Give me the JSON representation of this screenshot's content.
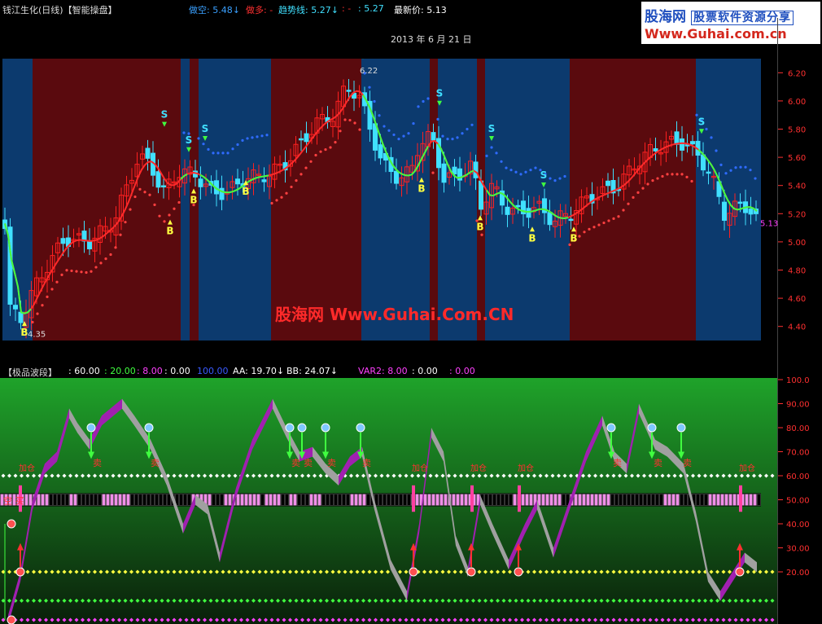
{
  "header": {
    "stock_title": "钱江生化(日线)【智能操盘】",
    "indicators": [
      {
        "label": "做空: 5.48↓",
        "color": "#3aa0ff"
      },
      {
        "label": "做多: -",
        "color": "#ff3030"
      },
      {
        "label": "趋势线: 5.27↓",
        "color": "#40e0ff"
      },
      {
        "label": ": - ",
        "color": "#ff3030"
      },
      {
        "label": ": 5.27",
        "color": "#40e0ff"
      },
      {
        "label": "最新价: 5.13",
        "color": "#ffffff"
      }
    ],
    "date": "2013 年 6 月 21 日"
  },
  "logo": {
    "brand": "股海网",
    "slogan": "股票软件资源分享",
    "url": "Www.Guhai.com.cn"
  },
  "watermark": "股海网 Www.Guhai.Com.CN",
  "price_axis": [
    "6.20",
    "6.00",
    "5.80",
    "5.60",
    "5.40",
    "5.20",
    "5.00",
    "4.80",
    "4.60",
    "4.40"
  ],
  "price_annotations": {
    "high": "6.22",
    "low": "4.35",
    "last": "5.13"
  },
  "signal_letters": {
    "sell": "S",
    "buy": "B"
  },
  "indicator_panel": {
    "name": "【极品波段】",
    "values": [
      {
        "label": ": 60.00",
        "color": "#ffffff"
      },
      {
        "label": ": 20.00",
        "color": "#40ff40"
      },
      {
        "label": ": 8.00",
        "color": "#ff40ff"
      },
      {
        "label": ": 0.00",
        "color": "#ffffff"
      },
      {
        "label": "100.00",
        "color": "#3a5aff"
      },
      {
        "label": "AA: 19.70↓",
        "color": "#ffffff"
      },
      {
        "label": "BB: 24.07↓",
        "color": "#ffffff"
      },
      {
        "label": "VAR2: 8.00",
        "color": "#ff40ff"
      },
      {
        "label": ": 0.00",
        "color": "#ffffff"
      },
      {
        "label": ": 0.00",
        "color": "#ff40ff"
      }
    ],
    "axis": [
      "100.0",
      "90.00",
      "80.00",
      "70.00",
      "60.00",
      "50.00",
      "40.00",
      "30.00",
      "20.00"
    ],
    "labels": {
      "sell": "卖",
      "add": "加仓",
      "buy": "买",
      "empty_buy": "空 买"
    }
  },
  "colors": {
    "bull_bg": "#5a0a0e",
    "bear_bg": "#0c3a6e",
    "up_candle": "#ff2020",
    "down_candle": "#40e0ff"
  }
}
